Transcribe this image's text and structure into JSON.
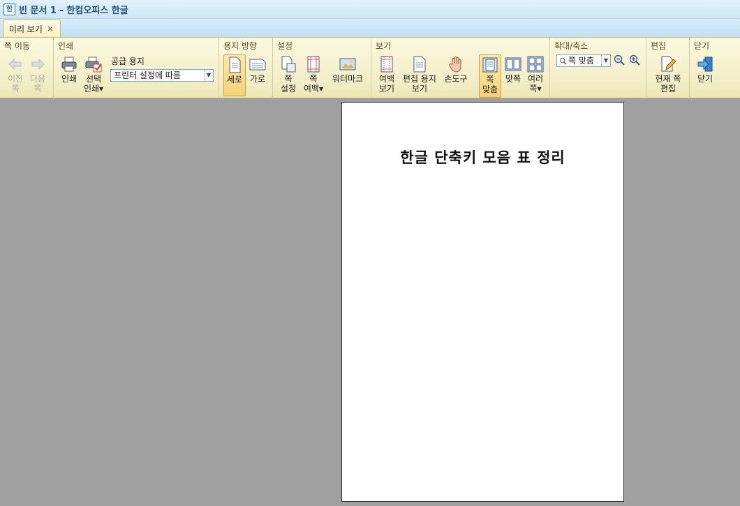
{
  "window": {
    "title": "빈 문서 1 - 한컴오피스 한글",
    "app_icon_glyph": "한"
  },
  "tabs": [
    {
      "label": "미리 보기",
      "close": "×"
    }
  ],
  "ribbon": {
    "page_nav": {
      "label": "쪽 이동",
      "prev": [
        "이전",
        "쪽"
      ],
      "next": [
        "다음",
        "쪽"
      ]
    },
    "print": {
      "label": "인쇄",
      "print_btn": "인쇄",
      "select_print": [
        "선택",
        "인쇄"
      ],
      "paper_label": "공급 용지",
      "paper_value": "프린터 설정에 따름"
    },
    "orientation": {
      "label": "용지 방향",
      "portrait": "세로",
      "landscape": "가로"
    },
    "settings": {
      "label": "설정",
      "page_setup": [
        "쪽",
        "설정"
      ],
      "page_margin": [
        "쪽",
        "여백"
      ],
      "watermark": "워터마크"
    },
    "view": {
      "label": "보기",
      "margin_view": [
        "여백",
        "보기"
      ],
      "edit_paper_view": [
        "편집 용지",
        "보기"
      ],
      "hand_tool": "손도구",
      "fit_page": [
        "쪽",
        "맞춤"
      ],
      "fit_width": "맞쪽",
      "multi_page": [
        "여러",
        "쪽"
      ]
    },
    "zoom": {
      "label": "확대/축소",
      "value": "쪽 맞춤"
    },
    "edit": {
      "label": "편집",
      "edit_current": [
        "현재 쪽",
        "편집"
      ]
    },
    "close": {
      "label": "닫기",
      "close_btn": "닫기"
    }
  },
  "document": {
    "title": "한글 단축키 모음 표 정리"
  }
}
